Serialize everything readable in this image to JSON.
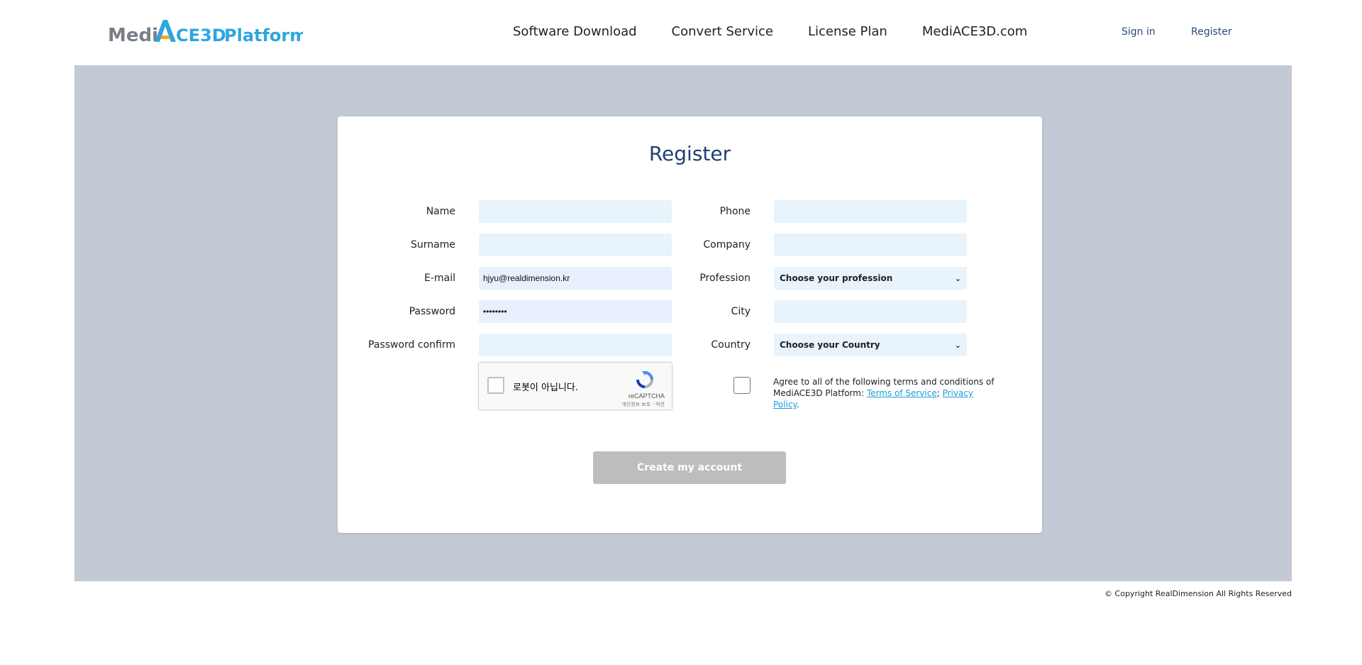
{
  "header": {
    "logo": {
      "medi": "Medi",
      "ace": "ACE",
      "three_d": "3D",
      "platform": "Platform"
    },
    "nav": [
      {
        "label": "Software Download"
      },
      {
        "label": "Convert Service"
      },
      {
        "label": "License Plan"
      },
      {
        "label": "MediACE3D.com"
      }
    ],
    "sign_in": "Sign in",
    "register": "Register"
  },
  "form": {
    "title": "Register",
    "left": {
      "name_label": "Name",
      "name_value": "",
      "surname_label": "Surname",
      "surname_value": "",
      "email_label": "E-mail",
      "email_value": "hjyu@realdimension.kr",
      "password_label": "Password",
      "password_value": "••••••••",
      "password_confirm_label": "Password confirm",
      "password_confirm_value": ""
    },
    "right": {
      "phone_label": "Phone",
      "phone_value": "",
      "company_label": "Company",
      "company_value": "",
      "profession_label": "Profession",
      "profession_selected": "Choose your profession",
      "city_label": "City",
      "city_value": "",
      "country_label": "Country",
      "country_selected": "Choose your Country"
    },
    "recaptcha": {
      "label": "로봇이 아닙니다.",
      "brand": "reCAPTCHA",
      "links": "개인정보 보호 - 약관",
      "icon": "recaptcha-icon"
    },
    "terms": {
      "text": "Agree to all of the following terms and conditions of MediACE3D Platform: ",
      "tos_link": "Terms of Service",
      "separator": ";",
      "privacy_link": "Privacy Policy",
      "end": "."
    },
    "submit_label": "Create my account"
  },
  "footer": {
    "copyright": "© Copyright RealDimension All Rights Reserved"
  },
  "colors": {
    "band_bg": "#c3c9d5",
    "title": "#1f3f72",
    "field_bg": "#e8f3fc",
    "link": "#1a9dd9",
    "button_disabled": "#bdbdbd",
    "logo_gray": "#7a7f86",
    "logo_blue": "#2ea6e0"
  }
}
